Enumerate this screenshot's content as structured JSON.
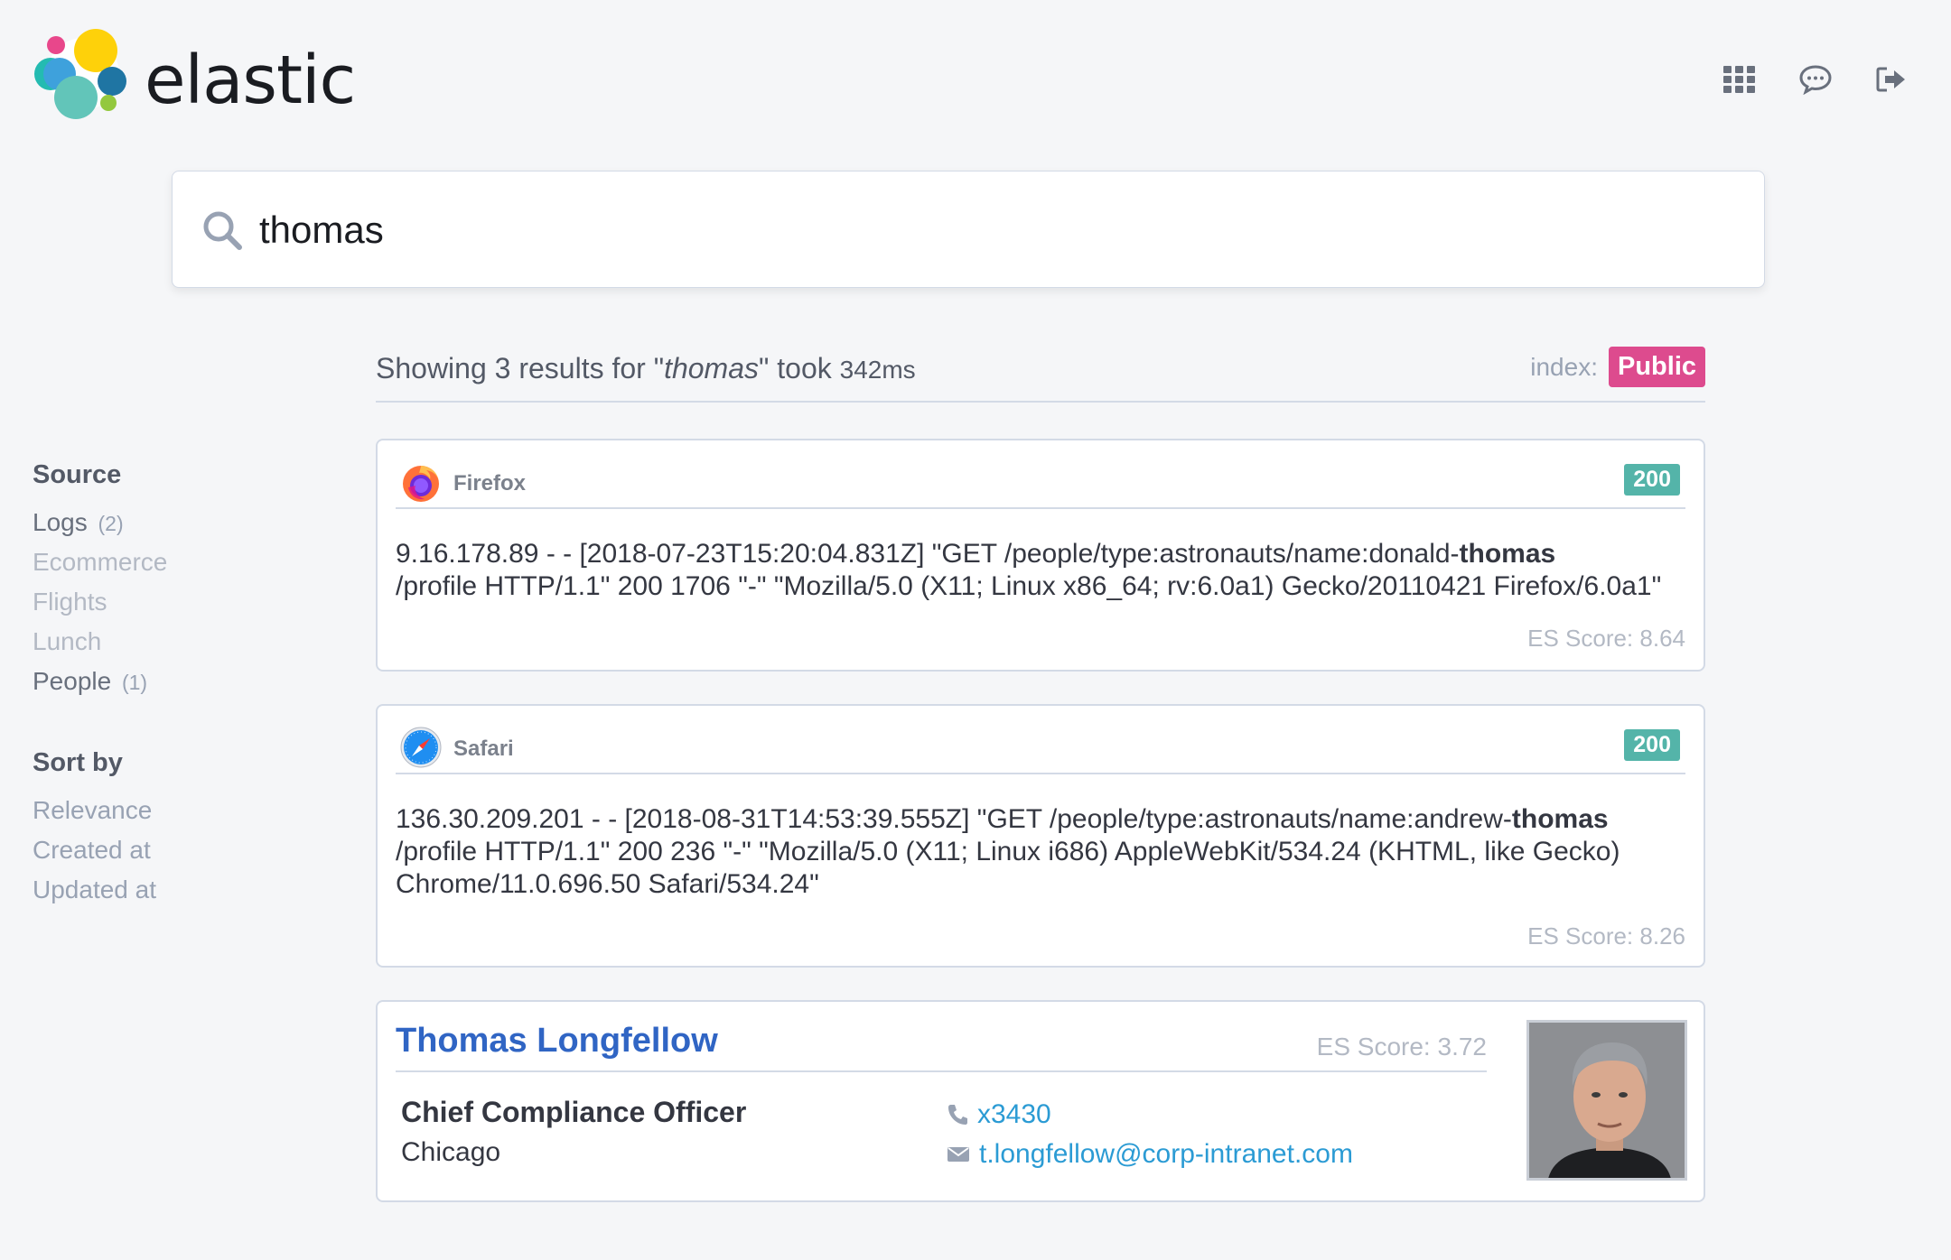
{
  "brand": {
    "name": "elastic"
  },
  "header": {
    "icons": [
      "apps-grid-icon",
      "chat-icon",
      "logout-icon"
    ]
  },
  "search": {
    "value": "thomas"
  },
  "summary": {
    "prefix": "Showing 3 results for \"",
    "query": "thomas",
    "mid": "\" took ",
    "took": "342ms",
    "index_label": "index:",
    "index_value": "Public",
    "index_color": "#dd4b8e"
  },
  "sidebar": {
    "source_title": "Source",
    "sources": [
      {
        "label": "Logs",
        "count": "(2)"
      },
      {
        "label": "Ecommerce",
        "count": ""
      },
      {
        "label": "Flights",
        "count": ""
      },
      {
        "label": "Lunch",
        "count": ""
      },
      {
        "label": "People",
        "count": "(1)"
      }
    ],
    "sort_title": "Sort by",
    "sort_options": [
      "Relevance",
      "Created at",
      "Updated at"
    ]
  },
  "results": [
    {
      "browser": "Firefox",
      "browser_icon": "firefox-icon",
      "status": "200",
      "log_before": "9.16.178.89 - - [2018-07-23T15:20:04.831Z] \"GET /people/type:astronauts/name:donald-",
      "log_highlight": "thomas",
      "log_after": "/profile HTTP/1.1\" 200 1706 \"-\" \"Mozilla/5.0 (X11; Linux x86_64; rv:6.0a1) Gecko/20110421 Firefox/6.0a1\"",
      "score": "ES Score: 8.64"
    },
    {
      "browser": "Safari",
      "browser_icon": "safari-icon",
      "status": "200",
      "log_before": "136.30.209.201 - - [2018-08-31T14:53:39.555Z] \"GET /people/type:astronauts/name:andrew-",
      "log_highlight": "thomas",
      "log_after": "/profile HTTP/1.1\" 200 236 \"-\" \"Mozilla/5.0 (X11; Linux i686) AppleWebKit/534.24 (KHTML, like Gecko) Chrome/11.0.696.50 Safari/534.24\"",
      "score": "ES Score: 8.26"
    }
  ],
  "person": {
    "name": "Thomas Longfellow",
    "score": "ES Score: 3.72",
    "title": "Chief Compliance Officer",
    "city": "Chicago",
    "phone": "x3430",
    "email": "t.longfellow@corp-intranet.com"
  },
  "colors": {
    "status_badge": "#54b4a9",
    "link": "#3065c4",
    "contact": "#2b9bd4"
  }
}
